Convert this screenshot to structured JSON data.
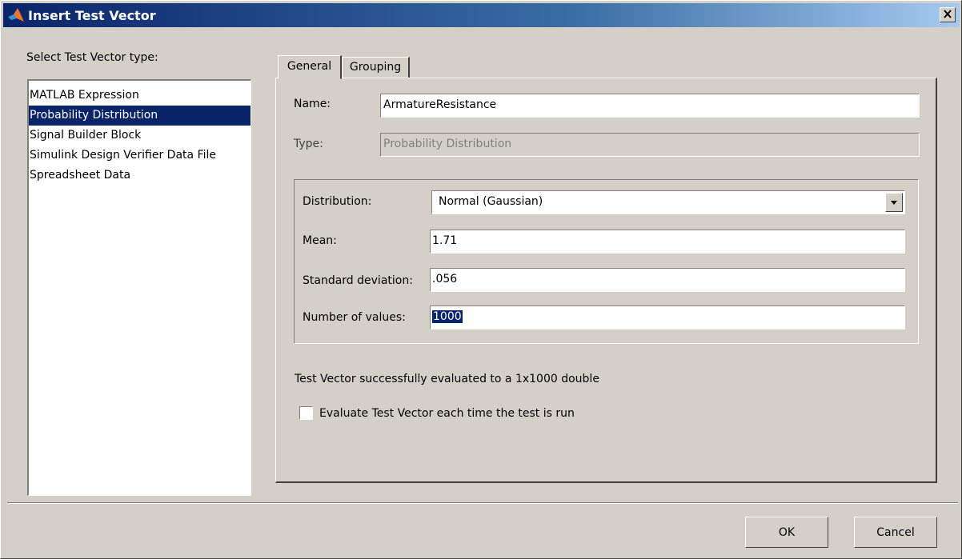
{
  "window": {
    "title": "Insert Test Vector"
  },
  "left_panel": {
    "label": "Select Test Vector type:",
    "items": [
      "MATLAB Expression",
      "Probability Distribution",
      "Signal Builder Block",
      "Simulink Design Verifier Data File",
      "Spreadsheet Data"
    ],
    "selected": "Probability Distribution"
  },
  "tabs": [
    {
      "label": "General",
      "active": true
    },
    {
      "label": "Grouping",
      "active": false
    }
  ],
  "general": {
    "name_label": "Name:",
    "name_value": "ArmatureResistance",
    "type_label": "Type:",
    "type_value": "Probability Distribution",
    "distribution_label": "Distribution:",
    "distribution_value": "Normal (Gaussian)",
    "mean_label": "Mean:",
    "mean_value": "1.71",
    "std_label": "Standard deviation:",
    "std_value": ".056",
    "num_label": "Number of values:",
    "num_value": "1000",
    "status": "Test Vector successfully evaluated to a 1x1000 double",
    "checkbox_label": "Evaluate Test Vector each time the test is run",
    "checkbox_checked": false
  },
  "buttons": {
    "ok": "OK",
    "cancel": "Cancel"
  },
  "icons": {
    "app": "matlab-icon",
    "close": "close-icon",
    "dropdown": "chevron-down-icon"
  },
  "colors": {
    "selection": "#0a246a",
    "titlebar_start": "#0a246a",
    "titlebar_end": "#a6caf0",
    "window_bg": "#d4d0c8"
  }
}
